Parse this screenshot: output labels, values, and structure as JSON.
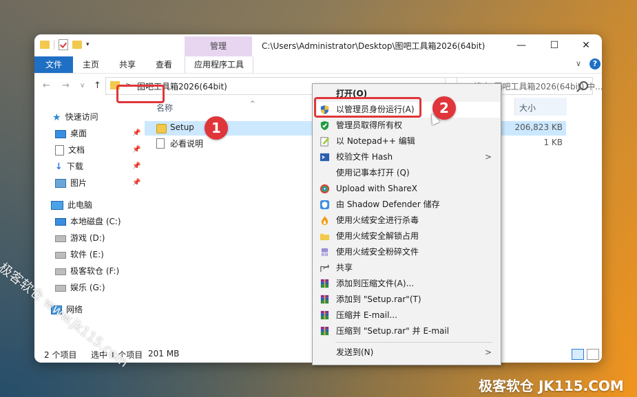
{
  "window": {
    "manage_tab": "管理",
    "title_path": "C:\\Users\\Administrator\\Desktop\\图吧工具箱2026(64bit)",
    "minimize_glyph": "—",
    "maximize_glyph": "☐",
    "close_glyph": "✕"
  },
  "ribbon": {
    "file": "文件",
    "home": "主页",
    "share": "共享",
    "view": "查看",
    "app_tools": "应用程序工具",
    "collapse_glyph": "∨",
    "help_glyph": "?"
  },
  "address": {
    "back_glyph": "←",
    "forward_glyph": "→",
    "recent_glyph": "∨",
    "up_glyph": "↑",
    "chevron": ">",
    "path": "图吧工具箱2026(64bit)",
    "refresh_glyph": "↻",
    "search_placeholder": "搜索\"图吧工具箱2026(64bit) 中..."
  },
  "nav": {
    "quick_access": "快速访问",
    "desktop": "桌面",
    "documents": "文档",
    "downloads": "下载",
    "pictures": "图片",
    "this_pc": "此电脑",
    "drive_c": "本地磁盘 (C:)",
    "drive_d": "游戏 (D:)",
    "drive_e": "软件 (E:)",
    "drive_f": "极客软仓 (F:)",
    "drive_g": "娱乐 (G:)",
    "network": "网络",
    "pin_glyph": "📌"
  },
  "columns": {
    "name": "名称",
    "size": "大小",
    "sort_glyph": "^"
  },
  "files": [
    {
      "name": "Setup",
      "size": "206,823 KB"
    },
    {
      "name": "必看说明",
      "size": "1 KB"
    }
  ],
  "status": {
    "count": "2 个项目",
    "selected": "选中 1 个项目",
    "size": "201 MB"
  },
  "context_menu": {
    "items": [
      {
        "label": "打开(O)"
      },
      {
        "label": "以管理员身份运行(A)"
      },
      {
        "label": "管理员取得所有权"
      },
      {
        "label": "以 Notepad++ 编辑"
      },
      {
        "label": "校验文件 Hash"
      },
      {
        "label": "使用记事本打开 (Q)"
      },
      {
        "label": "Upload with ShareX"
      },
      {
        "label": "由 Shadow Defender 储存"
      },
      {
        "label": "使用火绒安全进行杀毒"
      },
      {
        "label": "使用火绒安全解锁占用"
      },
      {
        "label": "使用火绒安全粉碎文件"
      },
      {
        "label": "共享"
      },
      {
        "label": "添加到压缩文件(A)..."
      },
      {
        "label": "添加到 \"Setup.rar\"(T)"
      },
      {
        "label": "压缩并 E-mail..."
      },
      {
        "label": "压缩到 \"Setup.rar\" 并 E-mail"
      },
      {
        "label": "发送到(N)"
      }
    ],
    "submenu_glyph": ">"
  },
  "annotations": {
    "badge1": "1",
    "badge2": "2"
  },
  "watermarks": {
    "diagonal": "极客软仓 www.jk115.com",
    "bottom_right": "极客软仓 JK115.COM"
  },
  "colors": {
    "accent_blue": "#1f6fc4",
    "selection": "#cce8ff",
    "highlight_red": "#e0353a",
    "manage_tab": "#e8d5f0"
  }
}
